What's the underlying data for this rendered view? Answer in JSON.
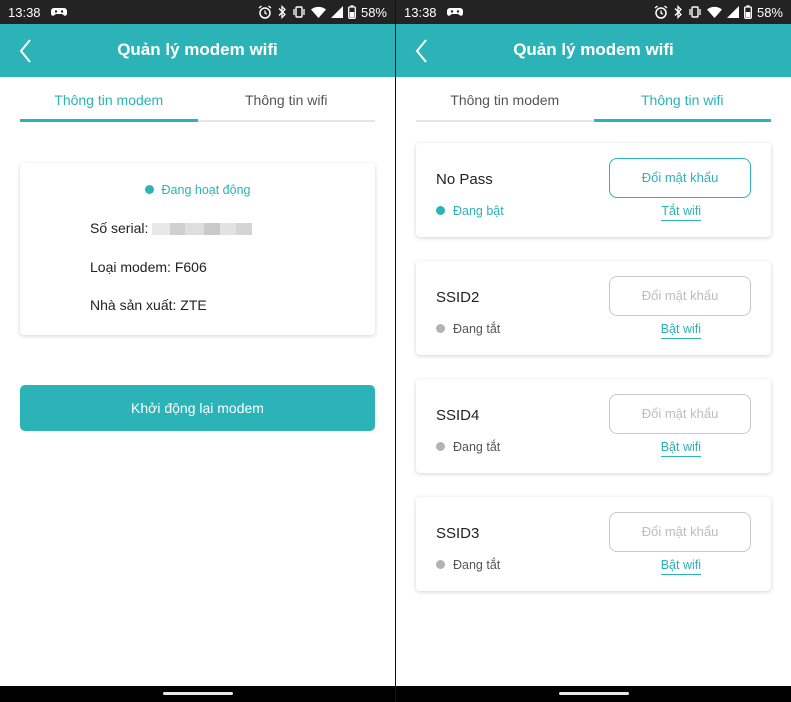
{
  "colors": {
    "accent": "#2bb3b7",
    "status_bar": "#232323",
    "inactive_dot": "#b3b3b3"
  },
  "status_bar": {
    "time": "13:38",
    "battery": "58%",
    "icons": [
      "game-controller-icon",
      "alarm-icon",
      "bluetooth-icon",
      "vibrate-icon",
      "wifi-icon",
      "signal-icon",
      "battery-icon"
    ]
  },
  "app_bar": {
    "title": "Quản lý modem wifi",
    "back_icon": "chevron-left-icon"
  },
  "tabs": [
    {
      "label": "Thông tin modem"
    },
    {
      "label": "Thông tin wifi"
    }
  ],
  "modem": {
    "status": "Đang hoạt động",
    "serial_label": "Số serial:",
    "type_text": "Loại modem: F606",
    "maker_text": "Nhà sản xuất: ZTE",
    "reboot_label": "Khởi động lại modem"
  },
  "wifi": [
    {
      "name": "No Pass",
      "status": "Đang bật",
      "on": true,
      "button": "Đổi mật khẩu",
      "link": "Tắt wifi"
    },
    {
      "name": "SSID2",
      "status": "Đang tắt",
      "on": false,
      "button": "Đổi mật khẩu",
      "link": "Bật wifi"
    },
    {
      "name": "SSID4",
      "status": "Đang tắt",
      "on": false,
      "button": "Đổi mật khẩu",
      "link": "Bật wifi"
    },
    {
      "name": "SSID3",
      "status": "Đang tắt",
      "on": false,
      "button": "Đổi mật khẩu",
      "link": "Bật wifi"
    }
  ]
}
